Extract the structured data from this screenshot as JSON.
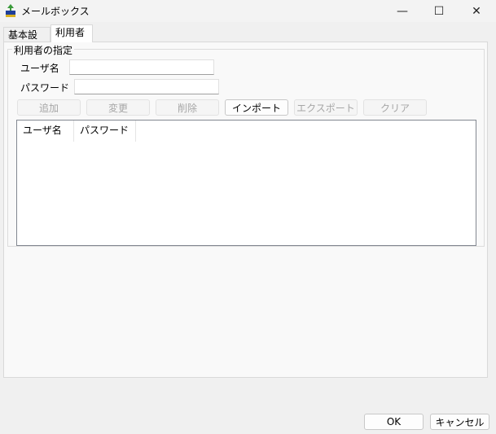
{
  "window": {
    "title": "メールボックス",
    "minimize_symbol": "—",
    "maximize_symbol": "☐",
    "close_symbol": "✕"
  },
  "tabs": [
    {
      "label": "基本設定",
      "selected": false
    },
    {
      "label": "利用者",
      "selected": true
    }
  ],
  "user_group": {
    "title": "利用者の指定",
    "username_label": "ユーザ名",
    "username_value": "",
    "password_label": "パスワード",
    "password_value": ""
  },
  "actions": [
    {
      "label": "追加",
      "enabled": false
    },
    {
      "label": "変更",
      "enabled": false
    },
    {
      "label": "削除",
      "enabled": false
    },
    {
      "label": "インポート",
      "enabled": true
    },
    {
      "label": "エクスポート",
      "enabled": false
    },
    {
      "label": "クリア",
      "enabled": false
    }
  ],
  "list": {
    "columns": [
      "ユーザ名",
      "パスワード"
    ],
    "rows": []
  },
  "dialog_buttons": {
    "ok": "OK",
    "cancel": "キャンセル"
  }
}
